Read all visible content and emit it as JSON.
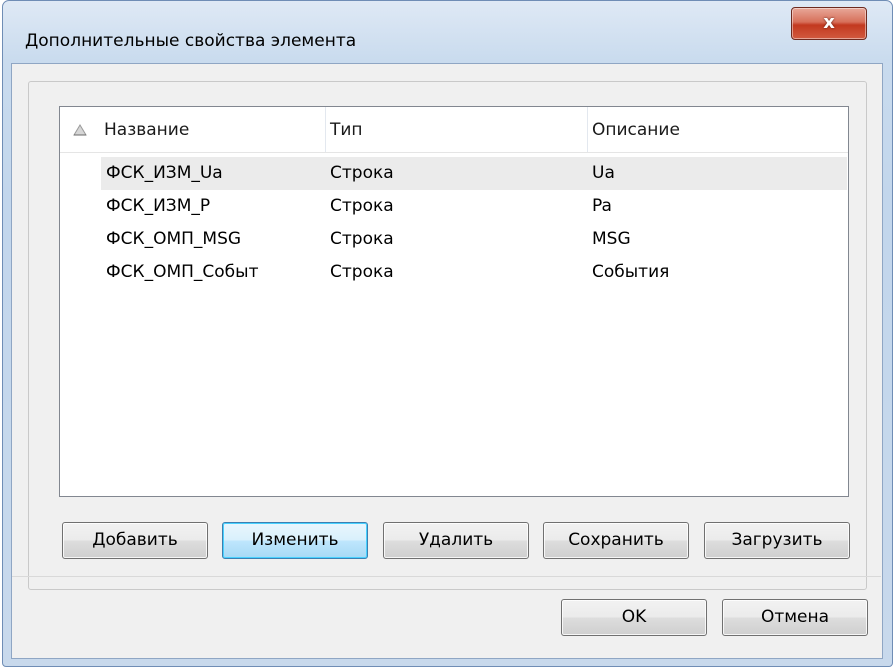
{
  "window": {
    "title": "Дополнительные свойства элемента",
    "close_label": "x"
  },
  "list": {
    "columns": [
      "Название",
      "Тип",
      "Описание"
    ],
    "sort_icon": "sort-ascending-icon",
    "rows": [
      {
        "name": "ФСК_ИЗМ_Ua",
        "type": "Строка",
        "desc": "Ua"
      },
      {
        "name": "ФСК_ИЗМ_P",
        "type": "Строка",
        "desc": "Pa"
      },
      {
        "name": "ФСК_ОМП_MSG",
        "type": "Строка",
        "desc": "MSG"
      },
      {
        "name": "ФСК_ОМП_Событ",
        "type": "Строка",
        "desc": "События"
      }
    ]
  },
  "actions": {
    "add": "Добавить",
    "edit": "Изменить",
    "delete": "Удалить",
    "save": "Сохранить",
    "load": "Загрузить"
  },
  "footer": {
    "ok": "OK",
    "cancel": "Отмена"
  },
  "colors": {
    "accent": "#3c7fb1",
    "close": "#c2391f",
    "selected_row": "#ebebeb"
  }
}
